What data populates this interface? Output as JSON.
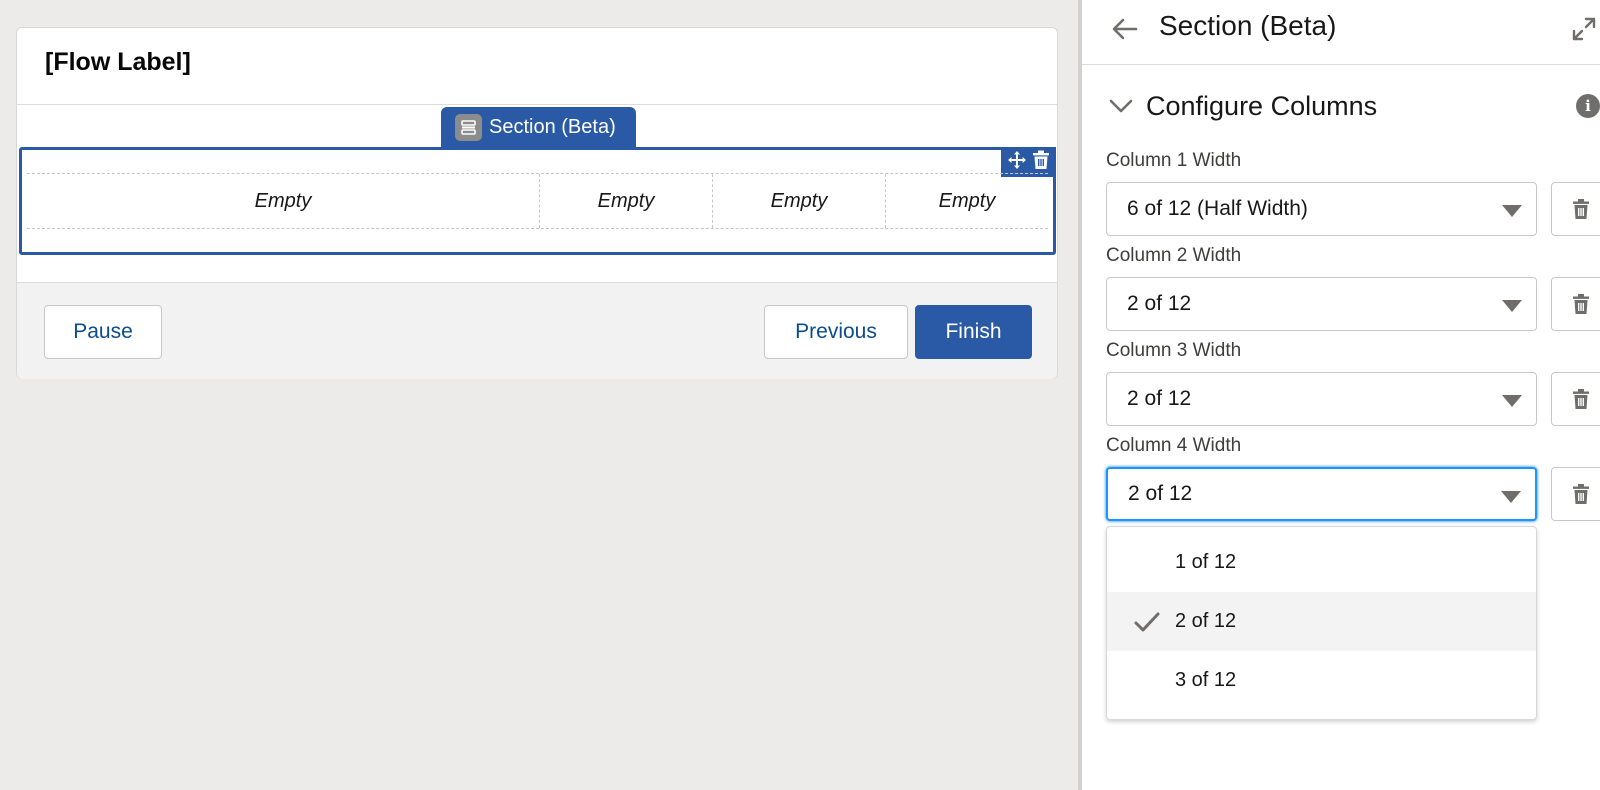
{
  "canvas": {
    "flow_label": "[Flow Label]",
    "section_tab_label": "Section (Beta)",
    "columns": [
      {
        "placeholder": "Empty"
      },
      {
        "placeholder": "Empty"
      },
      {
        "placeholder": "Empty"
      },
      {
        "placeholder": "Empty"
      }
    ],
    "footer": {
      "pause_label": "Pause",
      "previous_label": "Previous",
      "finish_label": "Finish"
    }
  },
  "panel": {
    "title": "Section (Beta)",
    "configure_section_title": "Configure Columns",
    "column_fields": [
      {
        "label": "Column 1 Width",
        "value": "6 of 12 (Half Width)"
      },
      {
        "label": "Column 2 Width",
        "value": "2 of 12"
      },
      {
        "label": "Column 3 Width",
        "value": "2 of 12"
      },
      {
        "label": "Column 4 Width",
        "value": "2 of 12"
      }
    ],
    "dropdown_options": [
      {
        "label": "1 of 12",
        "selected": false
      },
      {
        "label": "2 of 12",
        "selected": true
      },
      {
        "label": "3 of 12",
        "selected": false
      }
    ]
  },
  "colors": {
    "brand": "#2a5aa6",
    "focus": "#1b96ff",
    "link_text": "#0b4c8c"
  },
  "icons": [
    "section-icon",
    "move-icon",
    "trash-icon",
    "back-arrow-icon",
    "expand-icon",
    "chevron-down-icon",
    "info-icon",
    "caret-down-icon",
    "checkmark-icon"
  ]
}
